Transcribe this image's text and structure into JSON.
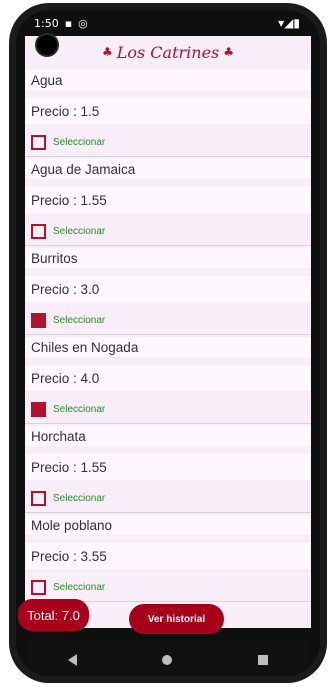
{
  "statusbar": {
    "left_text": "1:50",
    "right_text": "▾◢▮"
  },
  "app": {
    "title": "Los Catrines",
    "accent": "#a8001a"
  },
  "items": [
    {
      "name": "Agua",
      "price_text": "Precio : 1.5",
      "select_label": "Seleccionar",
      "selected": false
    },
    {
      "name": "Agua de Jamaica",
      "price_text": "Precio : 1.55",
      "select_label": "Seleccionar",
      "selected": false
    },
    {
      "name": "Burritos",
      "price_text": "Precio : 3.0",
      "select_label": "Seleccionar",
      "selected": true
    },
    {
      "name": "Chiles en Nogada",
      "price_text": "Precio : 4.0",
      "select_label": "Seleccionar",
      "selected": true
    },
    {
      "name": "Horchata",
      "price_text": "Precio : 1.55",
      "select_label": "Seleccionar",
      "selected": false
    },
    {
      "name": "Mole poblano",
      "price_text": "Precio : 3.55",
      "select_label": "Seleccionar",
      "selected": false
    }
  ],
  "footer": {
    "total_label": "Total: 7.0",
    "history_label": "Ver historial"
  }
}
